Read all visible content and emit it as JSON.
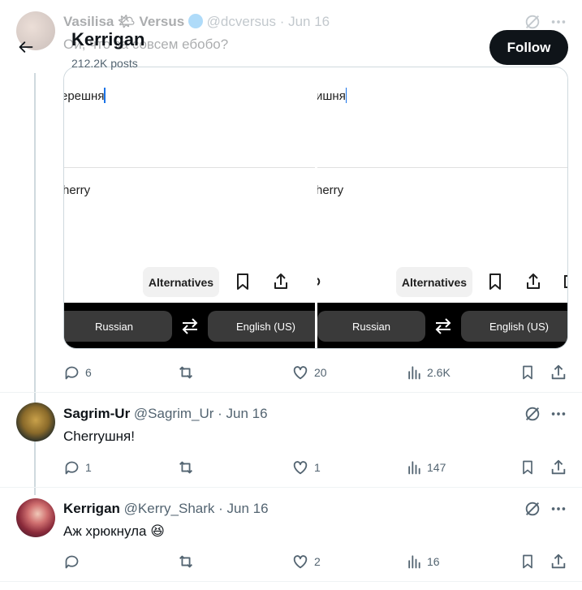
{
  "header": {
    "title": "Kerrigan",
    "posts_count": "212.2K posts",
    "follow_label": "Follow"
  },
  "top_tweet": {
    "display_name": "Vasilisa 🌤 Versus",
    "handle": "@dcversus",
    "time": "· Jun 16",
    "text": "Ой, что за совсем ебобо?"
  },
  "media": {
    "left_pane": {
      "source_text": "ерешня",
      "translation": "herry",
      "alternatives_label": "Alternatives",
      "lang_from": "Russian",
      "lang_to": "English (US)"
    },
    "right_pane": {
      "source_text": "ишня",
      "translation": "herry",
      "alternatives_label": "Alternatives",
      "lang_from": "Russian",
      "lang_to": "English (US)"
    }
  },
  "top_tweet_actions": {
    "replies": "6",
    "retweets": "",
    "likes": "20",
    "views": "2.6K"
  },
  "replies": [
    {
      "display_name": "Sagrim-Ur",
      "handle": "@Sagrim_Ur",
      "time": "· Jun 16",
      "text": "Cherryшня!",
      "actions": {
        "replies": "1",
        "retweets": "",
        "likes": "1",
        "views": "147"
      }
    },
    {
      "display_name": "Kerrigan",
      "handle": "@Kerry_Shark",
      "time": "· Jun 16",
      "text": "Аж хрюкнула 😆",
      "actions": {
        "replies": "",
        "retweets": "",
        "likes": "2",
        "views": "16"
      }
    }
  ],
  "colors": {
    "accent": "#0f1419",
    "muted": "#536471",
    "verified": "#1d9bf0"
  }
}
